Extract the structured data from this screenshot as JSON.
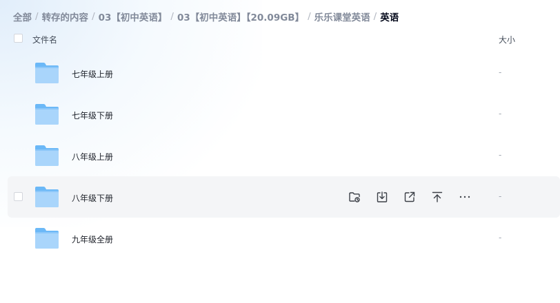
{
  "breadcrumb": [
    "全部",
    "转存的内容",
    "03【初中英语】",
    "03【初中英语】【20.09GB】",
    "乐乐课堂英语",
    "英语"
  ],
  "separator": "/",
  "columns": {
    "name": "文件名",
    "size": "大小"
  },
  "files": [
    {
      "name": "七年级上册",
      "size": "-"
    },
    {
      "name": "七年级下册",
      "size": "-"
    },
    {
      "name": "八年级上册",
      "size": "-"
    },
    {
      "name": "八年级下册",
      "size": "-"
    },
    {
      "name": "九年级全册",
      "size": "-"
    }
  ],
  "row_actions": [
    "folder-sync-icon",
    "download-icon",
    "share-icon",
    "move-top-icon",
    "more-icon"
  ],
  "colors": {
    "folder_light": "#a9d5fb",
    "folder_dark": "#6bb8f7",
    "text_primary": "#1d2129",
    "hover_bg": "#f4f5f7"
  }
}
